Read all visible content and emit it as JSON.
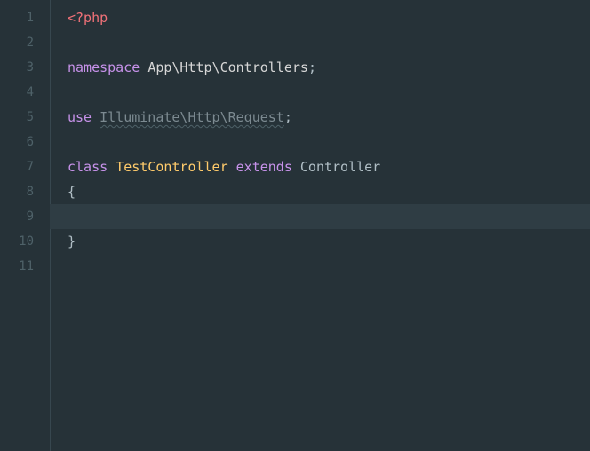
{
  "gutter": {
    "lineNumbers": [
      "1",
      "2",
      "3",
      "4",
      "5",
      "6",
      "7",
      "8",
      "9",
      "10",
      "11"
    ]
  },
  "code": {
    "l1": {
      "openTag": "<?php"
    },
    "l3": {
      "kw": "namespace",
      "sp": " ",
      "ns": "App\\Http\\Controllers",
      "semi": ";"
    },
    "l5": {
      "kw": "use",
      "sp": " ",
      "ns": "Illuminate\\Http\\Request",
      "semi": ";"
    },
    "l7": {
      "kw1": "class",
      "sp1": " ",
      "cls": "TestController",
      "sp2": " ",
      "kw2": "extends",
      "sp3": " ",
      "base": "Controller"
    },
    "l8": {
      "brace": "{"
    },
    "l10": {
      "brace": "}"
    }
  },
  "state": {
    "currentLine": 9
  }
}
